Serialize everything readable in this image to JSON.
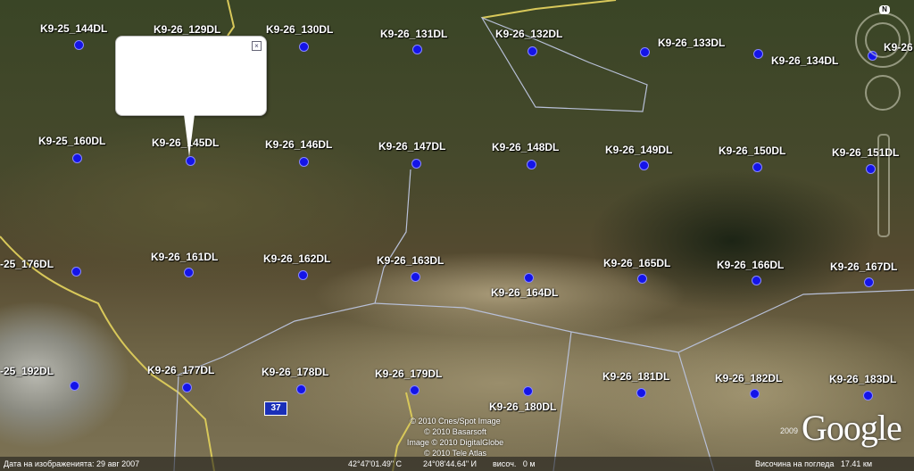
{
  "placemarks": [
    "K9-25_144DL",
    "K9-26_129DL",
    "K9-26_130DL",
    "K9-26_131DL",
    "K9-26_132DL",
    "K9-26_133DL",
    "K9-26_134DL",
    "K9-26",
    "K9-25_160DL",
    "K9-26_145DL",
    "K9-26_146DL",
    "K9-26_147DL",
    "K9-26_148DL",
    "K9-26_149DL",
    "K9-26_150DL",
    "K9-26_151DL",
    "-25_176DL",
    "K9-26_161DL",
    "K9-26_162DL",
    "K9-26_163DL",
    "K9-26_164DL",
    "K9-26_165DL",
    "K9-26_166DL",
    "K9-26_167DL",
    "-25_192DL",
    "K9-26_177DL",
    "K9-26_178DL",
    "K9-26_179DL",
    "K9-26_180DL",
    "K9-26_181DL",
    "K9-26_182DL",
    "K9-26_183DL"
  ],
  "popup": {
    "close_icon": "×"
  },
  "road_sign": "37",
  "credits": [
    "© 2010 Cnes/Spot Image",
    "© 2010 Basarsoft",
    "Image © 2010 DigitalGlobe",
    "© 2010 Tele Atlas"
  ],
  "logo": "Google",
  "logo_year": "2009",
  "status": {
    "imagery_date": "Дата на изображенията: 29 авг 2007",
    "lat": "42°47'01.49\" С",
    "lon": "24°08'44.64\" И",
    "elev": "височ.   0 м",
    "eye_alt": "Височина на погледа   17.41 км"
  },
  "compass": {
    "north": "N"
  }
}
